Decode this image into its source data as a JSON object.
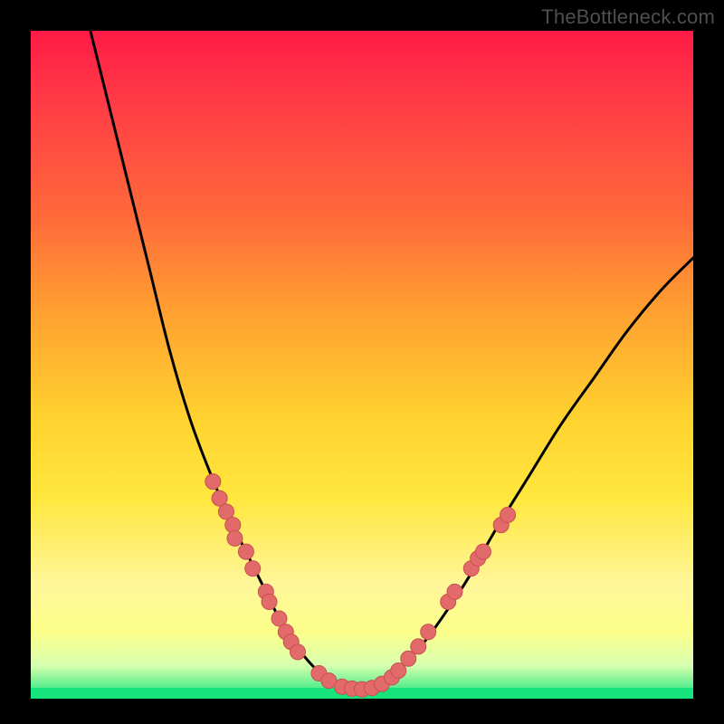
{
  "watermark": "TheBottleneck.com",
  "colors": {
    "frame": "#000000",
    "curve": "#000000",
    "marker_fill": "#e26a6a",
    "marker_stroke": "#c94f50",
    "green_band": "#16e37c"
  },
  "chart_data": {
    "type": "line",
    "title": "",
    "xlabel": "",
    "ylabel": "",
    "xlim": [
      0,
      100
    ],
    "ylim": [
      0,
      100
    ],
    "note": "No axes, ticks, or numeric labels are visible. Curve and marker coordinates are estimated in percentage of the inner plot area (0,0 = top-left, 100,100 = bottom-right).",
    "series": [
      {
        "name": "left-curve",
        "type": "line",
        "points_pct": [
          [
            9,
            0
          ],
          [
            12,
            12
          ],
          [
            15,
            24
          ],
          [
            18,
            36
          ],
          [
            21,
            48
          ],
          [
            24,
            58
          ],
          [
            27,
            66
          ],
          [
            30,
            73
          ],
          [
            33,
            79
          ],
          [
            36,
            85
          ],
          [
            38,
            89
          ],
          [
            40,
            92
          ],
          [
            42,
            94.5
          ],
          [
            44,
            96.5
          ],
          [
            46,
            98
          ],
          [
            48,
            98.8
          ]
        ]
      },
      {
        "name": "right-curve",
        "type": "line",
        "points_pct": [
          [
            48,
            98.8
          ],
          [
            50,
            98.8
          ],
          [
            52,
            98.2
          ],
          [
            54,
            97
          ],
          [
            56,
            95
          ],
          [
            59,
            92
          ],
          [
            62,
            88
          ],
          [
            66,
            82
          ],
          [
            70,
            75
          ],
          [
            75,
            67
          ],
          [
            80,
            59
          ],
          [
            85,
            52
          ],
          [
            90,
            45
          ],
          [
            95,
            39
          ],
          [
            100,
            34
          ]
        ]
      }
    ],
    "markers": {
      "name": "highlighted-points",
      "type": "scatter",
      "points_pct": [
        [
          27.5,
          67.5
        ],
        [
          28.5,
          70
        ],
        [
          29.5,
          72
        ],
        [
          30.5,
          74
        ],
        [
          30.8,
          76
        ],
        [
          32.5,
          78
        ],
        [
          33.5,
          80.5
        ],
        [
          35.5,
          84
        ],
        [
          36,
          85.5
        ],
        [
          37.5,
          88
        ],
        [
          38.5,
          90
        ],
        [
          39.3,
          91.5
        ],
        [
          40.3,
          93
        ],
        [
          43.5,
          96.2
        ],
        [
          45,
          97.3
        ],
        [
          47,
          98.2
        ],
        [
          48.5,
          98.5
        ],
        [
          50,
          98.6
        ],
        [
          51.5,
          98.4
        ],
        [
          53,
          97.8
        ],
        [
          54.5,
          96.8
        ],
        [
          55.5,
          95.8
        ],
        [
          57,
          94
        ],
        [
          58.5,
          92.2
        ],
        [
          60,
          90
        ],
        [
          63,
          85.5
        ],
        [
          64,
          84
        ],
        [
          66.5,
          80.5
        ],
        [
          67.5,
          79
        ],
        [
          68.3,
          78
        ],
        [
          71,
          74
        ],
        [
          72,
          72.5
        ]
      ]
    }
  }
}
